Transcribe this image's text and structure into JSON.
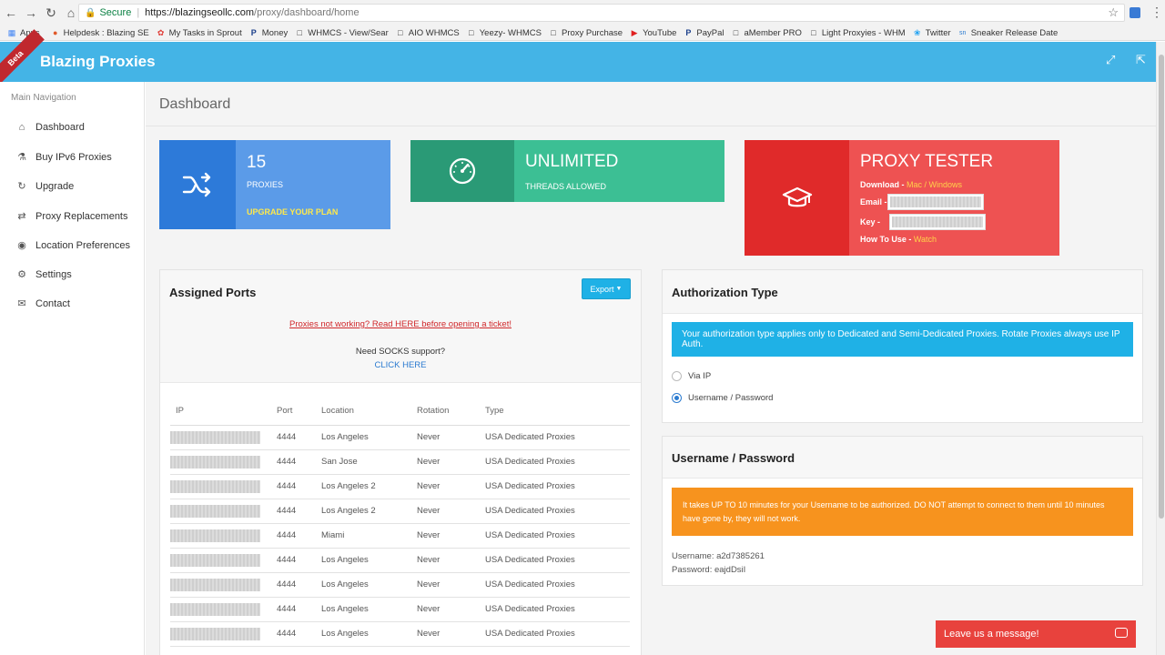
{
  "browser": {
    "secure_label": "Secure",
    "url_host": "https://blazingseollc.com",
    "url_path": "/proxy/dashboard/home",
    "bookmarks": [
      {
        "label": "Apps",
        "icon": "apps-grid-icon"
      },
      {
        "label": "Helpdesk : Blazing SE",
        "icon": "helpdesk-icon"
      },
      {
        "label": "My Tasks in Sprout",
        "icon": "sprout-icon"
      },
      {
        "label": "Money",
        "icon": "paypal-icon"
      },
      {
        "label": "WHMCS - View/Sear",
        "icon": "page-icon"
      },
      {
        "label": "AIO WHMCS",
        "icon": "page-icon"
      },
      {
        "label": "Yeezy- WHMCS",
        "icon": "page-icon"
      },
      {
        "label": "Proxy Purchase",
        "icon": "page-icon"
      },
      {
        "label": "YouTube",
        "icon": "youtube-icon"
      },
      {
        "label": "PayPal",
        "icon": "paypal-icon"
      },
      {
        "label": "aMember PRO",
        "icon": "page-icon"
      },
      {
        "label": "Light Proxyies - WHM",
        "icon": "page-icon"
      },
      {
        "label": "Twitter",
        "icon": "twitter-icon"
      },
      {
        "label": "Sneaker Release Date",
        "icon": "sn-icon"
      }
    ]
  },
  "header": {
    "beta": "Beta",
    "brand": "Blazing Proxies"
  },
  "sidebar": {
    "heading": "Main Navigation",
    "items": [
      {
        "label": "Dashboard",
        "icon": "home-icon"
      },
      {
        "label": "Buy IPv6 Proxies",
        "icon": "flask-icon"
      },
      {
        "label": "Upgrade",
        "icon": "refresh-icon"
      },
      {
        "label": "Proxy Replacements",
        "icon": "exchange-icon"
      },
      {
        "label": "Location Preferences",
        "icon": "globe-icon"
      },
      {
        "label": "Settings",
        "icon": "gear-icon"
      },
      {
        "label": "Contact",
        "icon": "envelope-icon"
      }
    ]
  },
  "page": {
    "title": "Dashboard"
  },
  "tiles": {
    "proxies": {
      "value": "15",
      "label": "PROXIES",
      "link": "UPGRADE YOUR PLAN",
      "color": "#5b9be8",
      "icon_bg": "#2d7ad9"
    },
    "threads": {
      "value": "UNLIMITED",
      "label": "THREADS ALLOWED",
      "color": "#3cbf94",
      "icon_bg": "#2a9a76"
    },
    "tester": {
      "title": "PROXY TESTER",
      "download_label": "Download - ",
      "mac": "Mac",
      "slash": " / ",
      "windows": "Windows",
      "email_label": "Email - ",
      "key_label": "Key - ",
      "howto_label": "How To Use - ",
      "watch": "Watch",
      "color": "#ee5252",
      "icon_bg": "#e02a2a"
    }
  },
  "ports": {
    "title": "Assigned Ports",
    "export": "Export",
    "notice": "Proxies not working? Read HERE before opening a ticket!",
    "socks": "Need SOCKS support?",
    "click_here": "CLICK HERE",
    "columns": [
      "IP",
      "Port",
      "Location",
      "Rotation",
      "Type"
    ],
    "rows": [
      {
        "port": "4444",
        "location": "Los Angeles",
        "rotation": "Never",
        "type": "USA Dedicated Proxies"
      },
      {
        "port": "4444",
        "location": "San Jose",
        "rotation": "Never",
        "type": "USA Dedicated Proxies"
      },
      {
        "port": "4444",
        "location": "Los Angeles 2",
        "rotation": "Never",
        "type": "USA Dedicated Proxies"
      },
      {
        "port": "4444",
        "location": "Los Angeles 2",
        "rotation": "Never",
        "type": "USA Dedicated Proxies"
      },
      {
        "port": "4444",
        "location": "Miami",
        "rotation": "Never",
        "type": "USA Dedicated Proxies"
      },
      {
        "port": "4444",
        "location": "Los Angeles",
        "rotation": "Never",
        "type": "USA Dedicated Proxies"
      },
      {
        "port": "4444",
        "location": "Los Angeles",
        "rotation": "Never",
        "type": "USA Dedicated Proxies"
      },
      {
        "port": "4444",
        "location": "Los Angeles",
        "rotation": "Never",
        "type": "USA Dedicated Proxies"
      },
      {
        "port": "4444",
        "location": "Los Angeles",
        "rotation": "Never",
        "type": "USA Dedicated Proxies"
      }
    ]
  },
  "auth": {
    "title": "Authorization Type",
    "info": "Your authorization type applies only to Dedicated and Semi-Dedicated Proxies. Rotate Proxies always use IP Auth.",
    "options": [
      {
        "label": "Via IP",
        "selected": false
      },
      {
        "label": "Username / Password",
        "selected": true
      }
    ]
  },
  "userpass": {
    "title": "Username / Password",
    "warning": "It takes UP TO 10 minutes for your Username to be authorized. DO NOT attempt to connect to them until 10 minutes have gone by, they will not work.",
    "username_line": "Username: a2d7385261",
    "password_line": "Password: eajdDsiI"
  },
  "chat": {
    "label": "Leave us a message!"
  }
}
